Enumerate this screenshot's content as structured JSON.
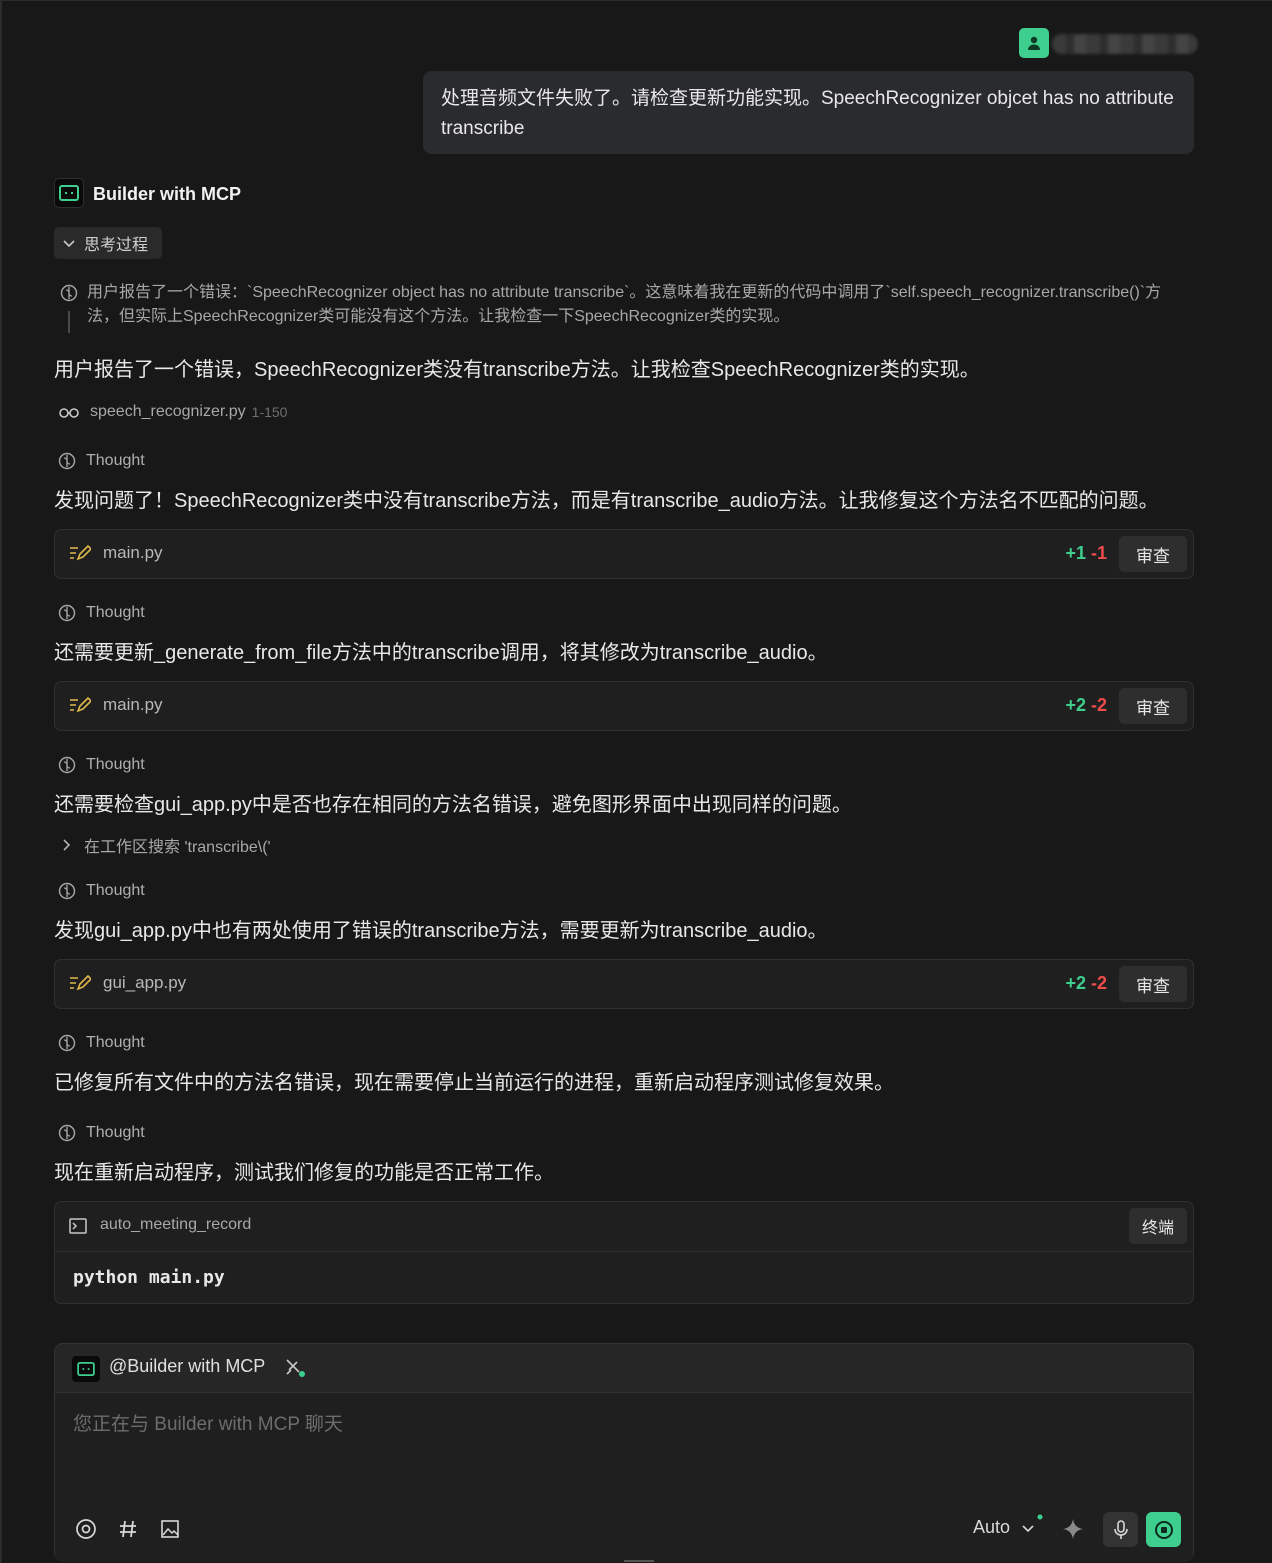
{
  "user": {
    "message": "处理音频文件失败了。请检查更新功能实现。SpeechRecognizer objcet has no attribute transcribe"
  },
  "agent": {
    "name": "Builder with MCP",
    "thinking_toggle": "思考过程",
    "thinking_text": "用户报告了一个错误：`SpeechRecognizer object has no attribute transcribe`。这意味着我在更新的代码中调用了`self.speech_recognizer.transcribe()`方法，但实际上SpeechRecognizer类可能没有这个方法。让我检查一下SpeechRecognizer类的实现。"
  },
  "steps": {
    "msg1": "用户报告了一个错误，SpeechRecognizer类没有transcribe方法。让我检查SpeechRecognizer类的实现。",
    "read_file": "speech_recognizer.py",
    "read_range": "1-150",
    "thought_label": "Thought",
    "msg2": "发现问题了！SpeechRecognizer类中没有transcribe方法，而是有transcribe_audio方法。让我修复这个方法名不匹配的问题。",
    "edit1": {
      "file": "main.py",
      "add": "+1",
      "del": "-1",
      "review": "审查"
    },
    "msg3": "还需要更新_generate_from_file方法中的transcribe调用，将其修改为transcribe_audio。",
    "edit2": {
      "file": "main.py",
      "add": "+2",
      "del": "-2",
      "review": "审查"
    },
    "msg4": "还需要检查gui_app.py中是否也存在相同的方法名错误，避免图形界面中出现同样的问题。",
    "search": "在工作区搜索 'transcribe\\('",
    "msg5": "发现gui_app.py中也有两处使用了错误的transcribe方法，需要更新为transcribe_audio。",
    "edit3": {
      "file": "gui_app.py",
      "add": "+2",
      "del": "-2",
      "review": "审查"
    },
    "msg6": "已修复所有文件中的方法名错误，现在需要停止当前运行的进程，重新启动程序测试修复效果。",
    "msg7": "现在重新启动程序，测试我们修复的功能是否正常工作。",
    "terminal": {
      "cwd": "auto_meeting_record",
      "button": "终端",
      "command": "python main.py"
    }
  },
  "input": {
    "mention": "@Builder with MCP",
    "placeholder": "您正在与 Builder with MCP 聊天",
    "mode": "Auto"
  },
  "colors": {
    "accent": "#3ecf8e",
    "add": "#3ecf8e",
    "del": "#f14c4c"
  }
}
